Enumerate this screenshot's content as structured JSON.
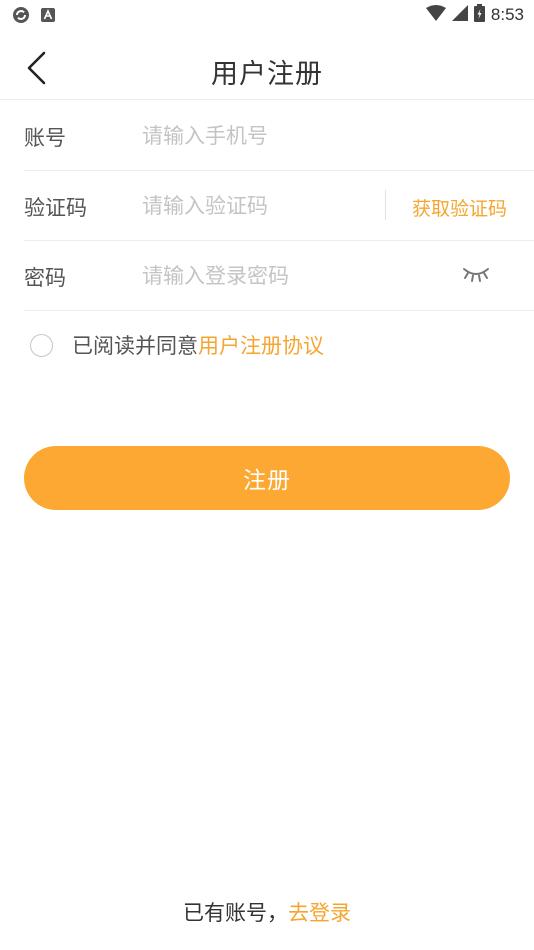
{
  "status_bar": {
    "time": "8:53",
    "icons": [
      "sync-icon",
      "a-notification-icon",
      "wifi-icon",
      "cell-signal-icon",
      "battery-charging-icon"
    ]
  },
  "nav": {
    "title": "用户注册",
    "back_icon": "chevron-left-icon"
  },
  "form": {
    "account": {
      "label": "账号",
      "placeholder": "请输入手机号",
      "value": ""
    },
    "code": {
      "label": "验证码",
      "placeholder": "请输入验证码",
      "value": "",
      "get_code_label": "获取验证码"
    },
    "password": {
      "label": "密码",
      "placeholder": "请输入登录密码",
      "value": "",
      "visibility_icon": "eye-closed-icon"
    }
  },
  "agreement": {
    "checked": false,
    "text": "已阅读并同意",
    "link": "用户注册协议"
  },
  "submit": {
    "label": "注册"
  },
  "footer": {
    "text": "已有账号，",
    "link": "去登录"
  },
  "colors": {
    "accent": "#f5a630",
    "button": "#fca833",
    "divider": "#ececec"
  }
}
